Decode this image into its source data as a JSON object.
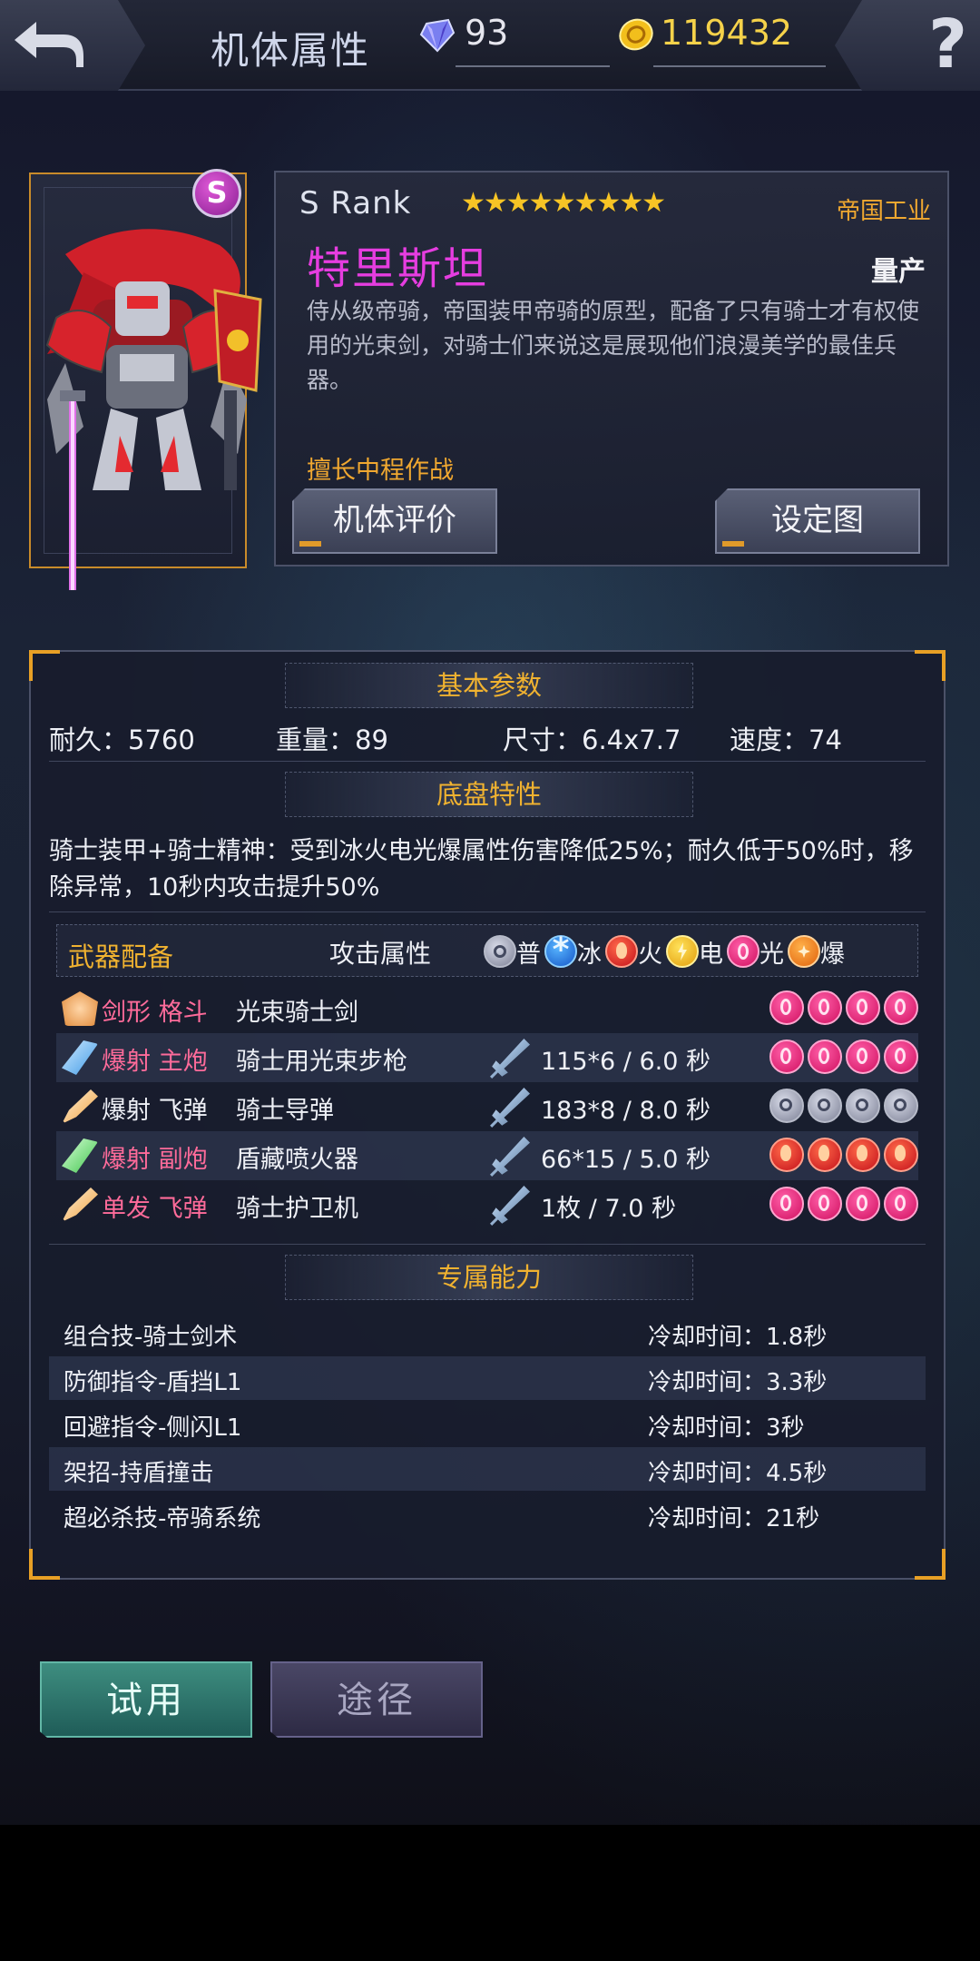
{
  "header": {
    "title": "机体属性",
    "gems": "93",
    "coins": "119432",
    "help_label": "?"
  },
  "mech": {
    "rank_badge": "S",
    "rank_text": "S  Rank",
    "stars": "★★★★★★★★★",
    "manufacturer": "帝国工业",
    "name": "特里斯坦",
    "production": "量产",
    "description": "侍从级帝骑，帝国装甲帝骑的原型，配备了只有骑士才有权使用的光束剑，对骑士们来说这是展现他们浪漫美学的最佳兵器。",
    "specialty": "擅长中程作战",
    "btn_eval": "机体评价",
    "btn_setting": "设定图"
  },
  "basic": {
    "heading": "基本参数",
    "durability": "耐久：5760",
    "weight": "重量：89",
    "size": "尺寸：6.4x7.7",
    "speed": "速度：74"
  },
  "chassis": {
    "heading": "底盘特性",
    "text": "骑士装甲+骑士精神：受到冰火电光爆属性伤害降低25%；耐久低于50%时，移除异常，10秒内攻击提升50%"
  },
  "weapons": {
    "heading": "武器配备",
    "attr_label": "攻击属性",
    "elements": [
      {
        "icon": "normal-element-icon",
        "label": "普"
      },
      {
        "icon": "ice-element-icon",
        "label": "冰"
      },
      {
        "icon": "fire-element-icon",
        "label": "火"
      },
      {
        "icon": "electric-element-icon",
        "label": "电"
      },
      {
        "icon": "light-element-icon",
        "label": "光"
      },
      {
        "icon": "burst-element-icon",
        "label": "爆"
      }
    ],
    "rows": [
      {
        "type": "剑形 格斗",
        "name": "光束骑士剑",
        "stat": "",
        "element": "light"
      },
      {
        "type": "爆射 主炮",
        "name": "骑士用光束步枪",
        "stat": "115*6  / 6.0 秒",
        "element": "light"
      },
      {
        "type": "爆射 飞弹",
        "name": "骑士导弹",
        "stat": "183*8  / 8.0 秒",
        "element": "normal"
      },
      {
        "type": "爆射 副炮",
        "name": "盾藏喷火器",
        "stat": "66*15  / 5.0 秒",
        "element": "fire"
      },
      {
        "type": "单发 飞弹",
        "name": "骑士护卫机",
        "stat": "1枚  / 7.0 秒",
        "element": "light"
      }
    ]
  },
  "abilities": {
    "heading": "专属能力",
    "rows": [
      {
        "name": "组合技-骑士剑术",
        "cooldown": "冷却时间：1.8秒"
      },
      {
        "name": "防御指令-盾挡L1",
        "cooldown": "冷却时间：3.3秒"
      },
      {
        "name": "回避指令-侧闪L1",
        "cooldown": "冷却时间：3秒"
      },
      {
        "name": "架招-持盾撞击",
        "cooldown": "冷却时间：4.5秒"
      },
      {
        "name": "超必杀技-帝骑系统",
        "cooldown": "冷却时间：21秒"
      }
    ]
  },
  "footer": {
    "try_label": "试用",
    "route_label": "途径"
  },
  "colors": {
    "accent_orange": "#f0b230",
    "name_magenta": "#e63de0",
    "weapon_type_pink": "#ff6b9a",
    "coin_gold": "#f5d24a"
  }
}
